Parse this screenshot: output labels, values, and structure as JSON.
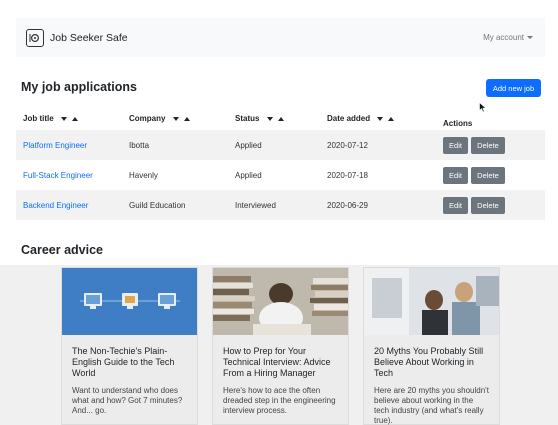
{
  "navbar": {
    "brand": "Job Seeker Safe",
    "account": "My account"
  },
  "applications": {
    "heading": "My job applications",
    "add_button": "Add new job",
    "columns": [
      "Job title",
      "Company",
      "Status",
      "Date added",
      "Actions"
    ],
    "rows": [
      {
        "title": "Platform Engineer",
        "company": "Ibotta",
        "status": "Applied",
        "date": "2020-07-12"
      },
      {
        "title": "Full-Stack Engineer",
        "company": "Havenly",
        "status": "Applied",
        "date": "2020-07-18"
      },
      {
        "title": "Backend Engineer",
        "company": "Guild Education",
        "status": "Interviewed",
        "date": "2020-06-29"
      }
    ],
    "edit_label": "Edit",
    "delete_label": "Delete"
  },
  "advice": {
    "heading": "Career advice",
    "cards": [
      {
        "title": "The Non-Techie's Plain-English Guide to the Tech World",
        "text": "Want to understand who does what and how? Got 7 minutes? And... go.",
        "image": "illustration-monitors"
      },
      {
        "title": "How to Prep for Your Technical Interview: Advice From a Hiring Manager",
        "text": "Here's how to ace the often dreaded step in the engineering interview process.",
        "image": "photo-books"
      },
      {
        "title": "20 Myths You Probably Still Believe About Working in Tech",
        "text": "Here are 20 myths you shouldn't believe about working in the tech industry (and what's really true).",
        "image": "photo-office"
      }
    ]
  },
  "colors": {
    "primary": "#0d6efd",
    "secondary": "#6c757d",
    "navbar_bg": "#f8f9fa",
    "stripe": "#f2f2f2"
  }
}
